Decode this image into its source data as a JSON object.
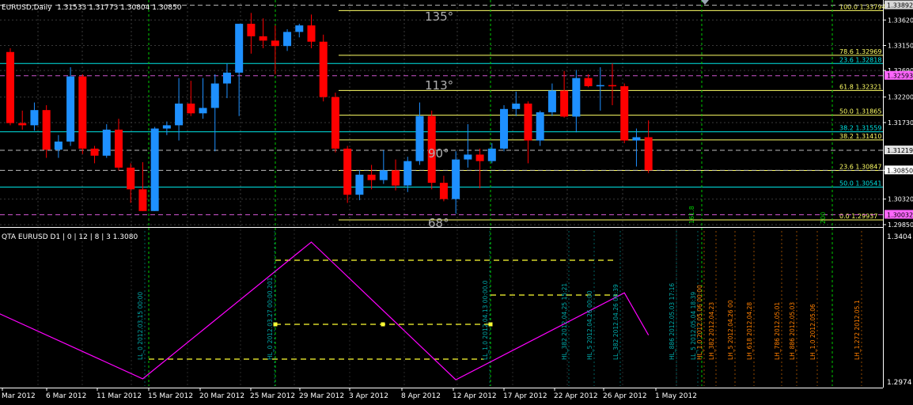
{
  "window": {
    "title": "EURUSD,Daily",
    "ohlc": "1.31533 1.31773 1.30804 1.30850"
  },
  "indicator": {
    "label": "QTA EURUSD D1 | 0 | 12 | 8 | 3 1.3080",
    "top_value": "1.3404",
    "bottom_value": "1.2974"
  },
  "colors": {
    "background": "#000000",
    "bull": "#1e90ff",
    "bear": "#ff0000",
    "fib": "#ffff66",
    "cyan": "#00e5e5",
    "zigzag": "#ff00ff",
    "yellow_dash": "#ffff33",
    "grid": "#ffffff",
    "green_vline": "#00cc00",
    "gann_text": "#b0b0b0"
  },
  "chart_data": [
    {
      "type": "candlestick",
      "symbol": "EURUSD",
      "timeframe": "Daily",
      "ylim": [
        1.2982,
        1.3393
      ],
      "grid": true,
      "price_ticks": [
        "1.33620",
        "1.33150",
        "1.32690",
        "1.32200",
        "1.31730",
        "1.30850",
        "1.30320",
        "1.29850"
      ],
      "price_labels_highlighted": [
        {
          "text": "1.33892",
          "value": 1.33892,
          "color": "#d8d8d8"
        },
        {
          "text": "1.32593",
          "value": 1.32593,
          "color": "#ff66ff"
        },
        {
          "text": "1.31219",
          "value": 1.31219,
          "color": "#e0e0e0"
        },
        {
          "text": "1.30850",
          "value": 1.3085,
          "color": "#ffffff"
        },
        {
          "text": "1.30032",
          "value": 1.30032,
          "color": "#ff66ff"
        }
      ],
      "x_labels": [
        "Mar 2012",
        "6 Mar 2012",
        "11 Mar 2012",
        "15 Mar 2012",
        "20 Mar 2012",
        "25 Mar 2012",
        "29 Mar 2012",
        "3 Apr 2012",
        "8 Apr 2012",
        "12 Apr 2012",
        "17 Apr 2012",
        "22 Apr 2012",
        "26 Apr 2012",
        "1 May 2012"
      ],
      "candles": [
        {
          "o": 1.3303,
          "h": 1.331,
          "l": 1.3168,
          "c": 1.3172
        },
        {
          "o": 1.3172,
          "h": 1.3195,
          "l": 1.316,
          "c": 1.3168
        },
        {
          "o": 1.3168,
          "h": 1.321,
          "l": 1.3158,
          "c": 1.3196
        },
        {
          "o": 1.3196,
          "h": 1.3205,
          "l": 1.3108,
          "c": 1.3123
        },
        {
          "o": 1.3123,
          "h": 1.315,
          "l": 1.3108,
          "c": 1.3138
        },
        {
          "o": 1.3138,
          "h": 1.3275,
          "l": 1.313,
          "c": 1.3258
        },
        {
          "o": 1.3258,
          "h": 1.3262,
          "l": 1.3115,
          "c": 1.3125
        },
        {
          "o": 1.3125,
          "h": 1.313,
          "l": 1.3098,
          "c": 1.3112
        },
        {
          "o": 1.3112,
          "h": 1.317,
          "l": 1.3108,
          "c": 1.316
        },
        {
          "o": 1.316,
          "h": 1.318,
          "l": 1.3085,
          "c": 1.309
        },
        {
          "o": 1.309,
          "h": 1.3098,
          "l": 1.3025,
          "c": 1.305
        },
        {
          "o": 1.305,
          "h": 1.31,
          "l": 1.301,
          "c": 1.301
        },
        {
          "o": 1.301,
          "h": 1.3165,
          "l": 1.301,
          "c": 1.3162
        },
        {
          "o": 1.3162,
          "h": 1.3175,
          "l": 1.315,
          "c": 1.3168
        },
        {
          "o": 1.3168,
          "h": 1.3255,
          "l": 1.314,
          "c": 1.3208
        },
        {
          "o": 1.3208,
          "h": 1.325,
          "l": 1.3185,
          "c": 1.319
        },
        {
          "o": 1.319,
          "h": 1.3255,
          "l": 1.318,
          "c": 1.32
        },
        {
          "o": 1.32,
          "h": 1.3262,
          "l": 1.312,
          "c": 1.3245
        },
        {
          "o": 1.3245,
          "h": 1.3282,
          "l": 1.3218,
          "c": 1.3265
        },
        {
          "o": 1.3265,
          "h": 1.3285,
          "l": 1.3185,
          "c": 1.3355
        },
        {
          "o": 1.3355,
          "h": 1.3375,
          "l": 1.33,
          "c": 1.3332
        },
        {
          "o": 1.3332,
          "h": 1.3365,
          "l": 1.331,
          "c": 1.3324
        },
        {
          "o": 1.3324,
          "h": 1.3352,
          "l": 1.3262,
          "c": 1.3314
        },
        {
          "o": 1.3314,
          "h": 1.3345,
          "l": 1.3305,
          "c": 1.334
        },
        {
          "o": 1.334,
          "h": 1.3355,
          "l": 1.333,
          "c": 1.3352
        },
        {
          "o": 1.3352,
          "h": 1.3372,
          "l": 1.331,
          "c": 1.3322
        },
        {
          "o": 1.3322,
          "h": 1.3335,
          "l": 1.3212,
          "c": 1.322
        },
        {
          "o": 1.322,
          "h": 1.3228,
          "l": 1.3118,
          "c": 1.3125
        },
        {
          "o": 1.3125,
          "h": 1.313,
          "l": 1.3025,
          "c": 1.304
        },
        {
          "o": 1.304,
          "h": 1.3085,
          "l": 1.303,
          "c": 1.3077
        },
        {
          "o": 1.3077,
          "h": 1.3095,
          "l": 1.305,
          "c": 1.3067
        },
        {
          "o": 1.3067,
          "h": 1.3122,
          "l": 1.306,
          "c": 1.3085
        },
        {
          "o": 1.3085,
          "h": 1.3105,
          "l": 1.3048,
          "c": 1.3057
        },
        {
          "o": 1.3057,
          "h": 1.311,
          "l": 1.3045,
          "c": 1.3102
        },
        {
          "o": 1.3102,
          "h": 1.321,
          "l": 1.3095,
          "c": 1.3185
        },
        {
          "o": 1.3185,
          "h": 1.3195,
          "l": 1.305,
          "c": 1.3062
        },
        {
          "o": 1.3062,
          "h": 1.3075,
          "l": 1.3028,
          "c": 1.3032
        },
        {
          "o": 1.3032,
          "h": 1.312,
          "l": 1.3005,
          "c": 1.3105
        },
        {
          "o": 1.3105,
          "h": 1.317,
          "l": 1.309,
          "c": 1.3114
        },
        {
          "o": 1.3114,
          "h": 1.3125,
          "l": 1.3052,
          "c": 1.3102
        },
        {
          "o": 1.3102,
          "h": 1.3135,
          "l": 1.3098,
          "c": 1.3125
        },
        {
          "o": 1.3125,
          "h": 1.3205,
          "l": 1.312,
          "c": 1.3198
        },
        {
          "o": 1.3198,
          "h": 1.323,
          "l": 1.3185,
          "c": 1.3208
        },
        {
          "o": 1.3208,
          "h": 1.3212,
          "l": 1.3098,
          "c": 1.314
        },
        {
          "o": 1.314,
          "h": 1.3195,
          "l": 1.313,
          "c": 1.3192
        },
        {
          "o": 1.3192,
          "h": 1.3245,
          "l": 1.3185,
          "c": 1.3232
        },
        {
          "o": 1.3232,
          "h": 1.3268,
          "l": 1.3182,
          "c": 1.3184
        },
        {
          "o": 1.3184,
          "h": 1.327,
          "l": 1.3155,
          "c": 1.3255
        },
        {
          "o": 1.3255,
          "h": 1.3262,
          "l": 1.3238,
          "c": 1.324
        },
        {
          "o": 1.324,
          "h": 1.3275,
          "l": 1.3195,
          "c": 1.3242
        },
        {
          "o": 1.3242,
          "h": 1.3282,
          "l": 1.3205,
          "c": 1.324
        },
        {
          "o": 1.324,
          "h": 1.3245,
          "l": 1.3135,
          "c": 1.314
        },
        {
          "o": 1.314,
          "h": 1.3162,
          "l": 1.3092,
          "c": 1.3146
        },
        {
          "o": 1.3146,
          "h": 1.3177,
          "l": 1.308,
          "c": 1.3085
        }
      ],
      "fib_levels": [
        {
          "text": "100.0 1.33794",
          "value": 1.33794,
          "color": "#ffff66"
        },
        {
          "text": "78.6 1.32969",
          "value": 1.32969,
          "color": "#ffff66"
        },
        {
          "text": "23.6 1.32818",
          "value": 1.32818,
          "color": "#00e5e5"
        },
        {
          "text": "61.8 1.32321",
          "value": 1.32321,
          "color": "#ffff66"
        },
        {
          "text": "50.0 1.31865",
          "value": 1.31865,
          "color": "#ffff66"
        },
        {
          "text": "38.2 1.31559",
          "value": 1.31559,
          "color": "#00e5e5"
        },
        {
          "text": "38.2 1.31410",
          "value": 1.3141,
          "color": "#ffff66"
        },
        {
          "text": "23.6 1.30847",
          "value": 1.30847,
          "color": "#ffff66"
        },
        {
          "text": "50.0 1.30541",
          "value": 1.30541,
          "color": "#00e5e5"
        },
        {
          "text": "0.0 1.29937",
          "value": 1.29937,
          "color": "#ffff66"
        }
      ],
      "gann_labels": [
        "135°",
        "113°",
        "90°",
        "68°"
      ],
      "vertical_markers": [
        "161.8",
        "200"
      ]
    },
    {
      "type": "line",
      "name": "QTA EURUSD D1",
      "ylim": [
        1.2974,
        1.3404
      ],
      "zigzag_points": [
        {
          "candle": -1,
          "value": 1.318
        },
        {
          "candle": 11,
          "value": 1.2986
        },
        {
          "candle": 25,
          "value": 1.339
        },
        {
          "candle": 37,
          "value": 1.2983
        },
        {
          "candle": 51,
          "value": 1.324
        },
        {
          "candle": 53,
          "value": 1.3115
        }
      ],
      "vertical_annotations": [
        {
          "text": "LL_0 2012.03.15 00:00",
          "color": "#00aaaa"
        },
        {
          "text": "HL_0 2012.03.27 00:00.201",
          "color": "#00aaaa"
        },
        {
          "text": "LL_1.0 2012.04.13 00:00.0",
          "color": "#00aaaa"
        },
        {
          "text": "HL_382 2012.04.25 15:21",
          "color": "#00aaaa"
        },
        {
          "text": "HL_5 2012.04.26 00:00",
          "color": "#00aaaa"
        },
        {
          "text": "LL_382 2012.04.26 08:39",
          "color": "#00aaaa"
        },
        {
          "text": "HL_886 2012.05.03 17:16",
          "color": "#00aaaa"
        },
        {
          "text": "LL_5 2012.05.04 18:39",
          "color": "#00aaaa"
        },
        {
          "text": "HL_1.0 2012.05.06 00:00",
          "color": "#ff7f00"
        },
        {
          "text": "LH_382 2012.04.23",
          "color": "#ff7f00"
        },
        {
          "text": "LH_5 2012.04.26 00",
          "color": "#ff7f00"
        },
        {
          "text": "LH_618 2012.04.28",
          "color": "#ff7f00"
        },
        {
          "text": "LH_786 2012.05.01",
          "color": "#ff7f00"
        },
        {
          "text": "LH_886 2012.05.03",
          "color": "#ff7f00"
        },
        {
          "text": "LH_1.0 2012.05.06",
          "color": "#ff7f00"
        },
        {
          "text": "LH_1.272 2012.05.1",
          "color": "#ff7f00"
        }
      ]
    }
  ]
}
